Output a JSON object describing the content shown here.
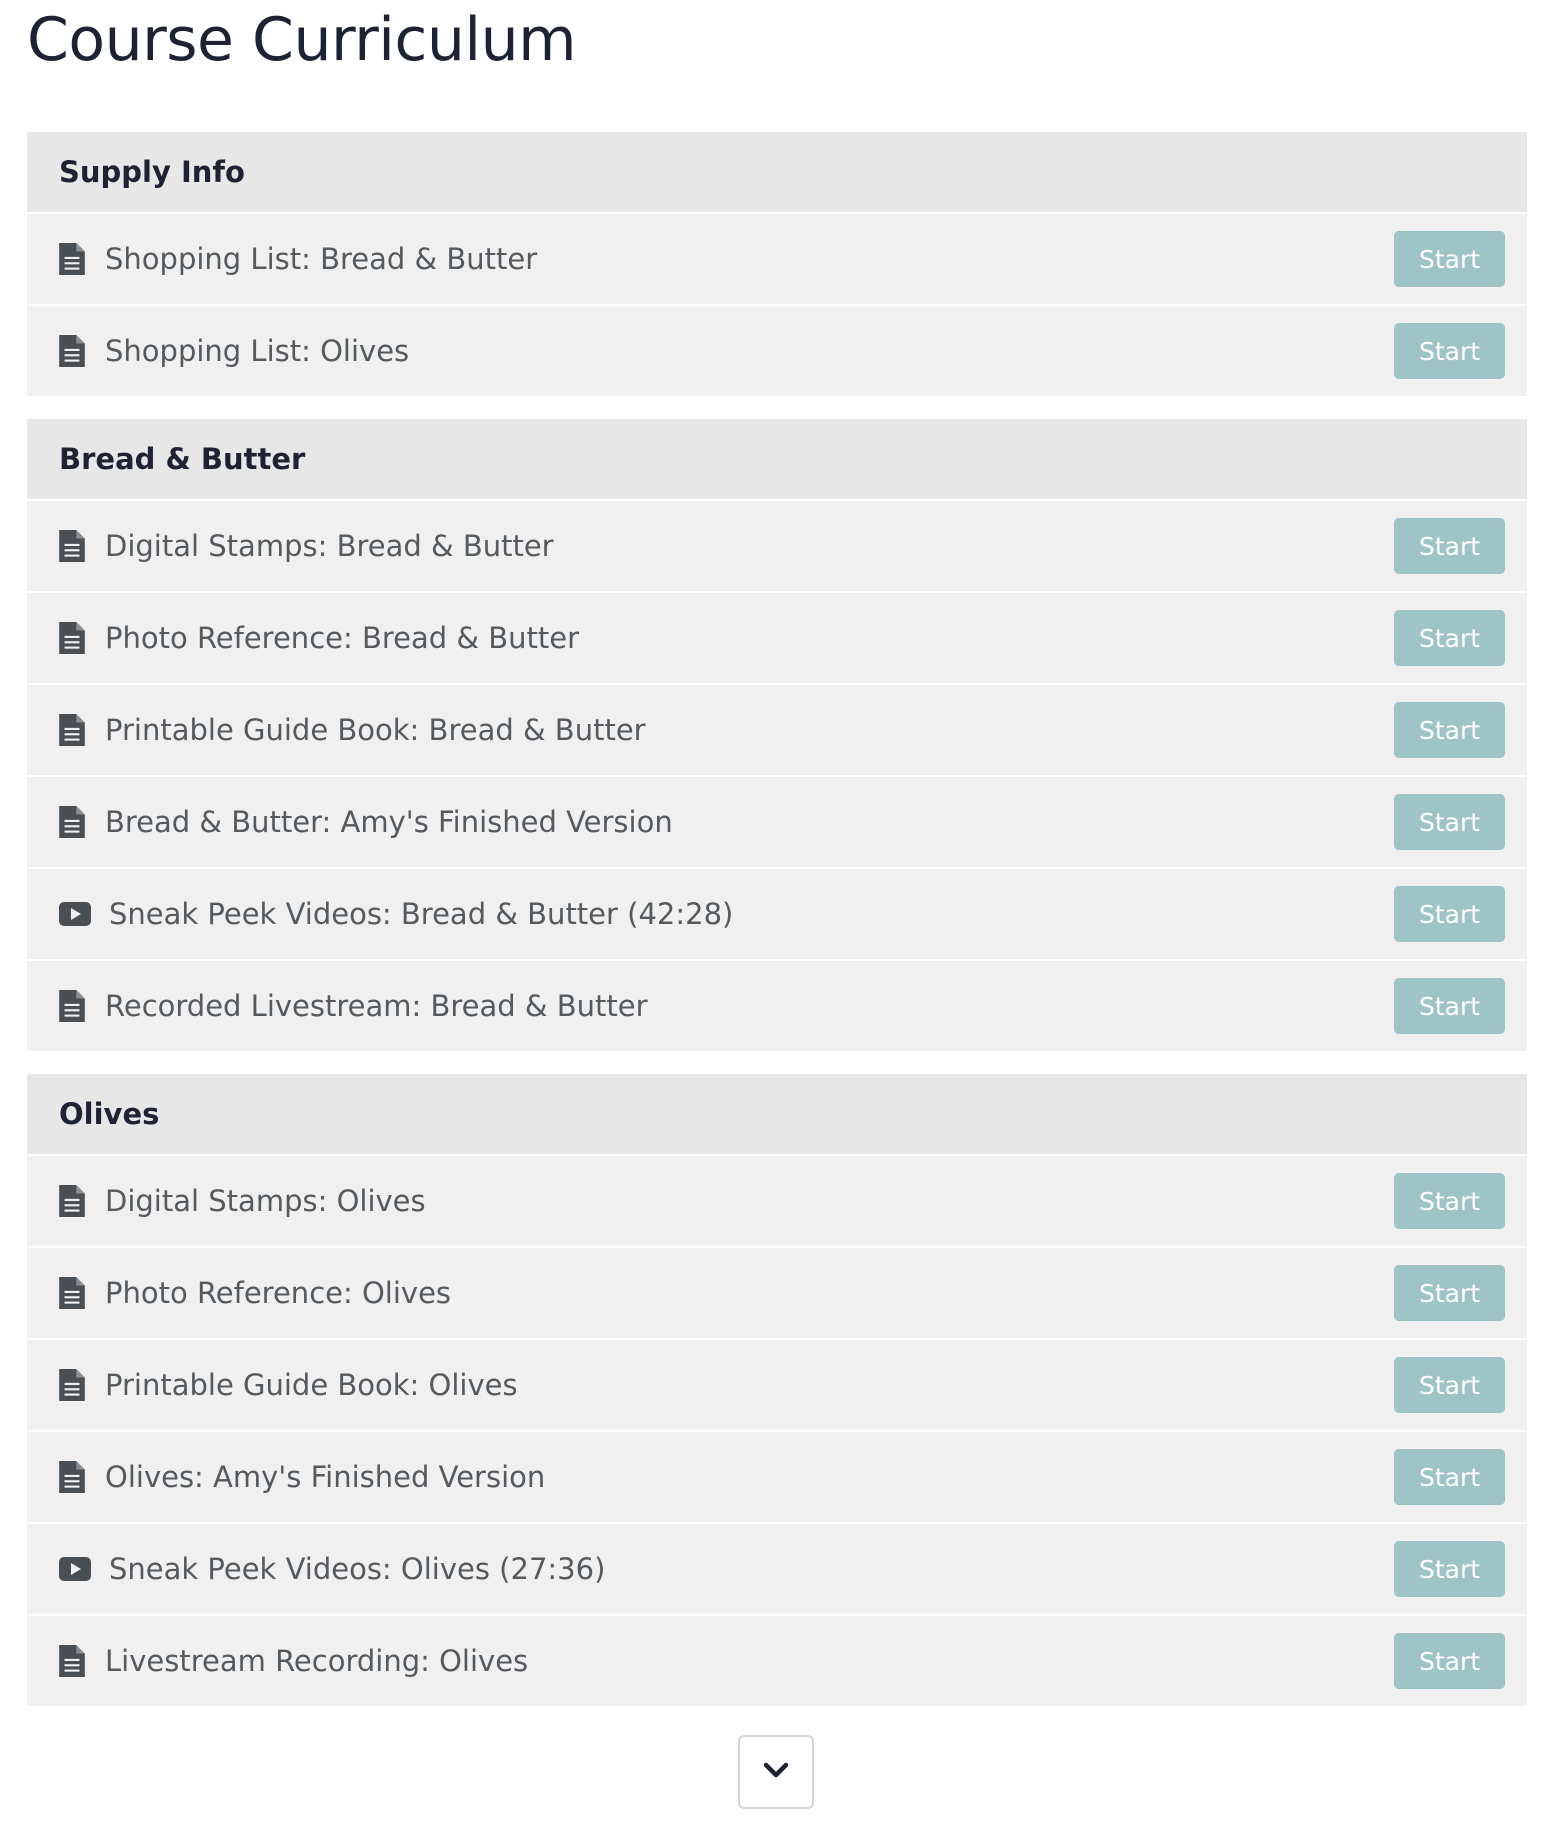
{
  "page": {
    "title": "Course Curriculum"
  },
  "sections": [
    {
      "title": "Supply Info",
      "lectures": [
        {
          "icon": "document-icon",
          "name": "Shopping List: Bread & Butter",
          "action": "Start"
        },
        {
          "icon": "document-icon",
          "name": "Shopping List: Olives",
          "action": "Start"
        }
      ]
    },
    {
      "title": "Bread & Butter",
      "lectures": [
        {
          "icon": "document-icon",
          "name": "Digital Stamps: Bread & Butter",
          "action": "Start"
        },
        {
          "icon": "document-icon",
          "name": "Photo Reference: Bread & Butter",
          "action": "Start"
        },
        {
          "icon": "document-icon",
          "name": "Printable Guide Book: Bread & Butter",
          "action": "Start"
        },
        {
          "icon": "document-icon",
          "name": "Bread & Butter: Amy's Finished Version",
          "action": "Start"
        },
        {
          "icon": "video-play-icon",
          "name": "Sneak Peek Videos: Bread & Butter (42:28)",
          "action": "Start"
        },
        {
          "icon": "document-icon",
          "name": "Recorded Livestream: Bread & Butter",
          "action": "Start"
        }
      ]
    },
    {
      "title": "Olives",
      "lectures": [
        {
          "icon": "document-icon",
          "name": "Digital Stamps: Olives",
          "action": "Start"
        },
        {
          "icon": "document-icon",
          "name": "Photo Reference: Olives",
          "action": "Start"
        },
        {
          "icon": "document-icon",
          "name": "Printable Guide Book: Olives",
          "action": "Start"
        },
        {
          "icon": "document-icon",
          "name": "Olives: Amy's Finished Version",
          "action": "Start"
        },
        {
          "icon": "video-play-icon",
          "name": "Sneak Peek Videos: Olives (27:36)",
          "action": "Start"
        },
        {
          "icon": "document-icon",
          "name": "Livestream Recording: Olives",
          "action": "Start"
        }
      ]
    }
  ],
  "scroll_button": {
    "icon": "chevron-down-icon"
  },
  "colors": {
    "title_text": "#1f2233",
    "section_header_bg": "#e7e7e7",
    "row_bg": "#f0f0f0",
    "row_text": "#555a5f",
    "start_button_bg": "#9fc4c8",
    "start_button_text": "#ffffff",
    "icon": "#4a4f54"
  }
}
